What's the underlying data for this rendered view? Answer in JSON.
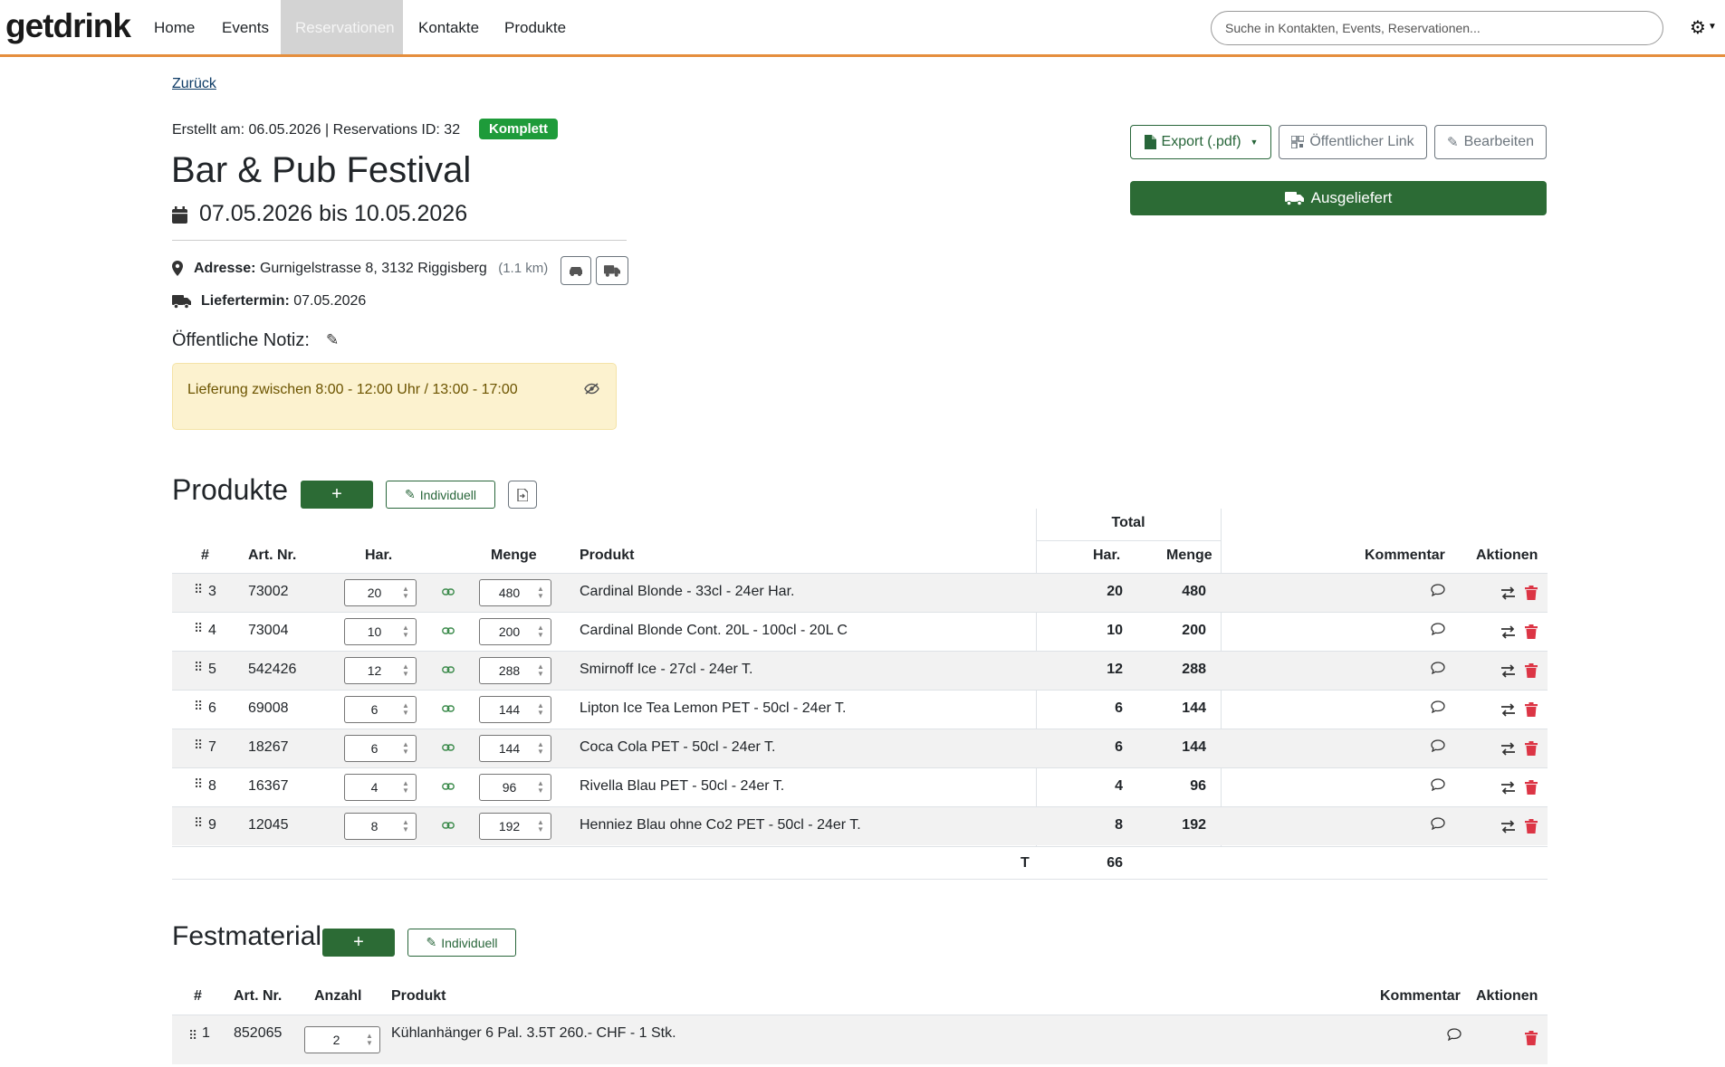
{
  "nav": {
    "brand": "getdrink",
    "items": [
      "Home",
      "Events",
      "Reservationen",
      "Kontakte",
      "Produkte"
    ],
    "search_placeholder": "Suche in Kontakten, Events, Reservationen..."
  },
  "back_link": "Zurück",
  "header": {
    "meta": "Erstellt am: 06.05.2026 | Reservations ID: 32",
    "status_badge": "Komplett",
    "title": "Bar & Pub Festival",
    "dates": "07.05.2026 bis 10.05.2026"
  },
  "actions": {
    "export": "Export (.pdf)",
    "public_link": "Öffentlicher Link",
    "edit": "Bearbeiten",
    "delivered": "Ausgeliefert"
  },
  "address": {
    "label": "Adresse:",
    "value": "Gurnigelstrasse 8, 3132 Riggisberg",
    "distance": "(1.1 km)"
  },
  "delivery": {
    "label": "Liefertermin:",
    "value": "07.05.2026"
  },
  "note": {
    "label": "Öffentliche Notiz:",
    "text": "Lieferung zwischen 8:00 - 12:00 Uhr / 13:00 - 17:00"
  },
  "products": {
    "title": "Produkte",
    "add_label": "+",
    "individual_label": "Individuell",
    "total_group": "Total",
    "columns": {
      "index": "#",
      "art_nr": "Art. Nr.",
      "har": "Har.",
      "menge": "Menge",
      "produkt": "Produkt",
      "total_har": "Har.",
      "total_menge": "Menge",
      "kommentar": "Kommentar",
      "aktionen": "Aktionen"
    },
    "rows": [
      {
        "index": "3",
        "art_nr": "73002",
        "har": "20",
        "menge": "480",
        "produkt": "Cardinal Blonde - 33cl - 24er Har.",
        "total_har": "20",
        "total_menge": "480"
      },
      {
        "index": "4",
        "art_nr": "73004",
        "har": "10",
        "menge": "200",
        "produkt": "Cardinal Blonde Cont. 20L - 100cl - 20L C",
        "total_har": "10",
        "total_menge": "200"
      },
      {
        "index": "5",
        "art_nr": "542426",
        "har": "12",
        "menge": "288",
        "produkt": "Smirnoff Ice - 27cl - 24er T.",
        "total_har": "12",
        "total_menge": "288"
      },
      {
        "index": "6",
        "art_nr": "69008",
        "har": "6",
        "menge": "144",
        "produkt": "Lipton Ice Tea Lemon PET - 50cl - 24er T.",
        "total_har": "6",
        "total_menge": "144"
      },
      {
        "index": "7",
        "art_nr": "18267",
        "har": "6",
        "menge": "144",
        "produkt": "Coca Cola PET - 50cl - 24er T.",
        "total_har": "6",
        "total_menge": "144"
      },
      {
        "index": "8",
        "art_nr": "16367",
        "har": "4",
        "menge": "96",
        "produkt": "Rivella Blau PET - 50cl - 24er T.",
        "total_har": "4",
        "total_menge": "96"
      },
      {
        "index": "9",
        "art_nr": "12045",
        "har": "8",
        "menge": "192",
        "produkt": "Henniez Blau ohne Co2 PET - 50cl - 24er T.",
        "total_har": "8",
        "total_menge": "192"
      }
    ],
    "footer": {
      "label": "T",
      "value": "66"
    }
  },
  "festmaterial": {
    "title": "Festmaterial",
    "add_label": "+",
    "individual_label": "Individuell",
    "columns": {
      "index": "#",
      "art_nr": "Art. Nr.",
      "anzahl": "Anzahl",
      "produkt": "Produkt",
      "kommentar": "Kommentar",
      "aktionen": "Aktionen"
    },
    "rows": [
      {
        "index": "1",
        "art_nr": "852065",
        "anzahl": "2",
        "produkt": "Kühlanhänger 6 Pal. 3.5T 260.- CHF - 1 Stk."
      }
    ]
  },
  "colors": {
    "accent": "#e58e3c",
    "primary_green": "#2c6b35",
    "badge_green": "#1e9b3a",
    "delete_red": "#dc3545",
    "note_bg": "#fcf2cf"
  }
}
